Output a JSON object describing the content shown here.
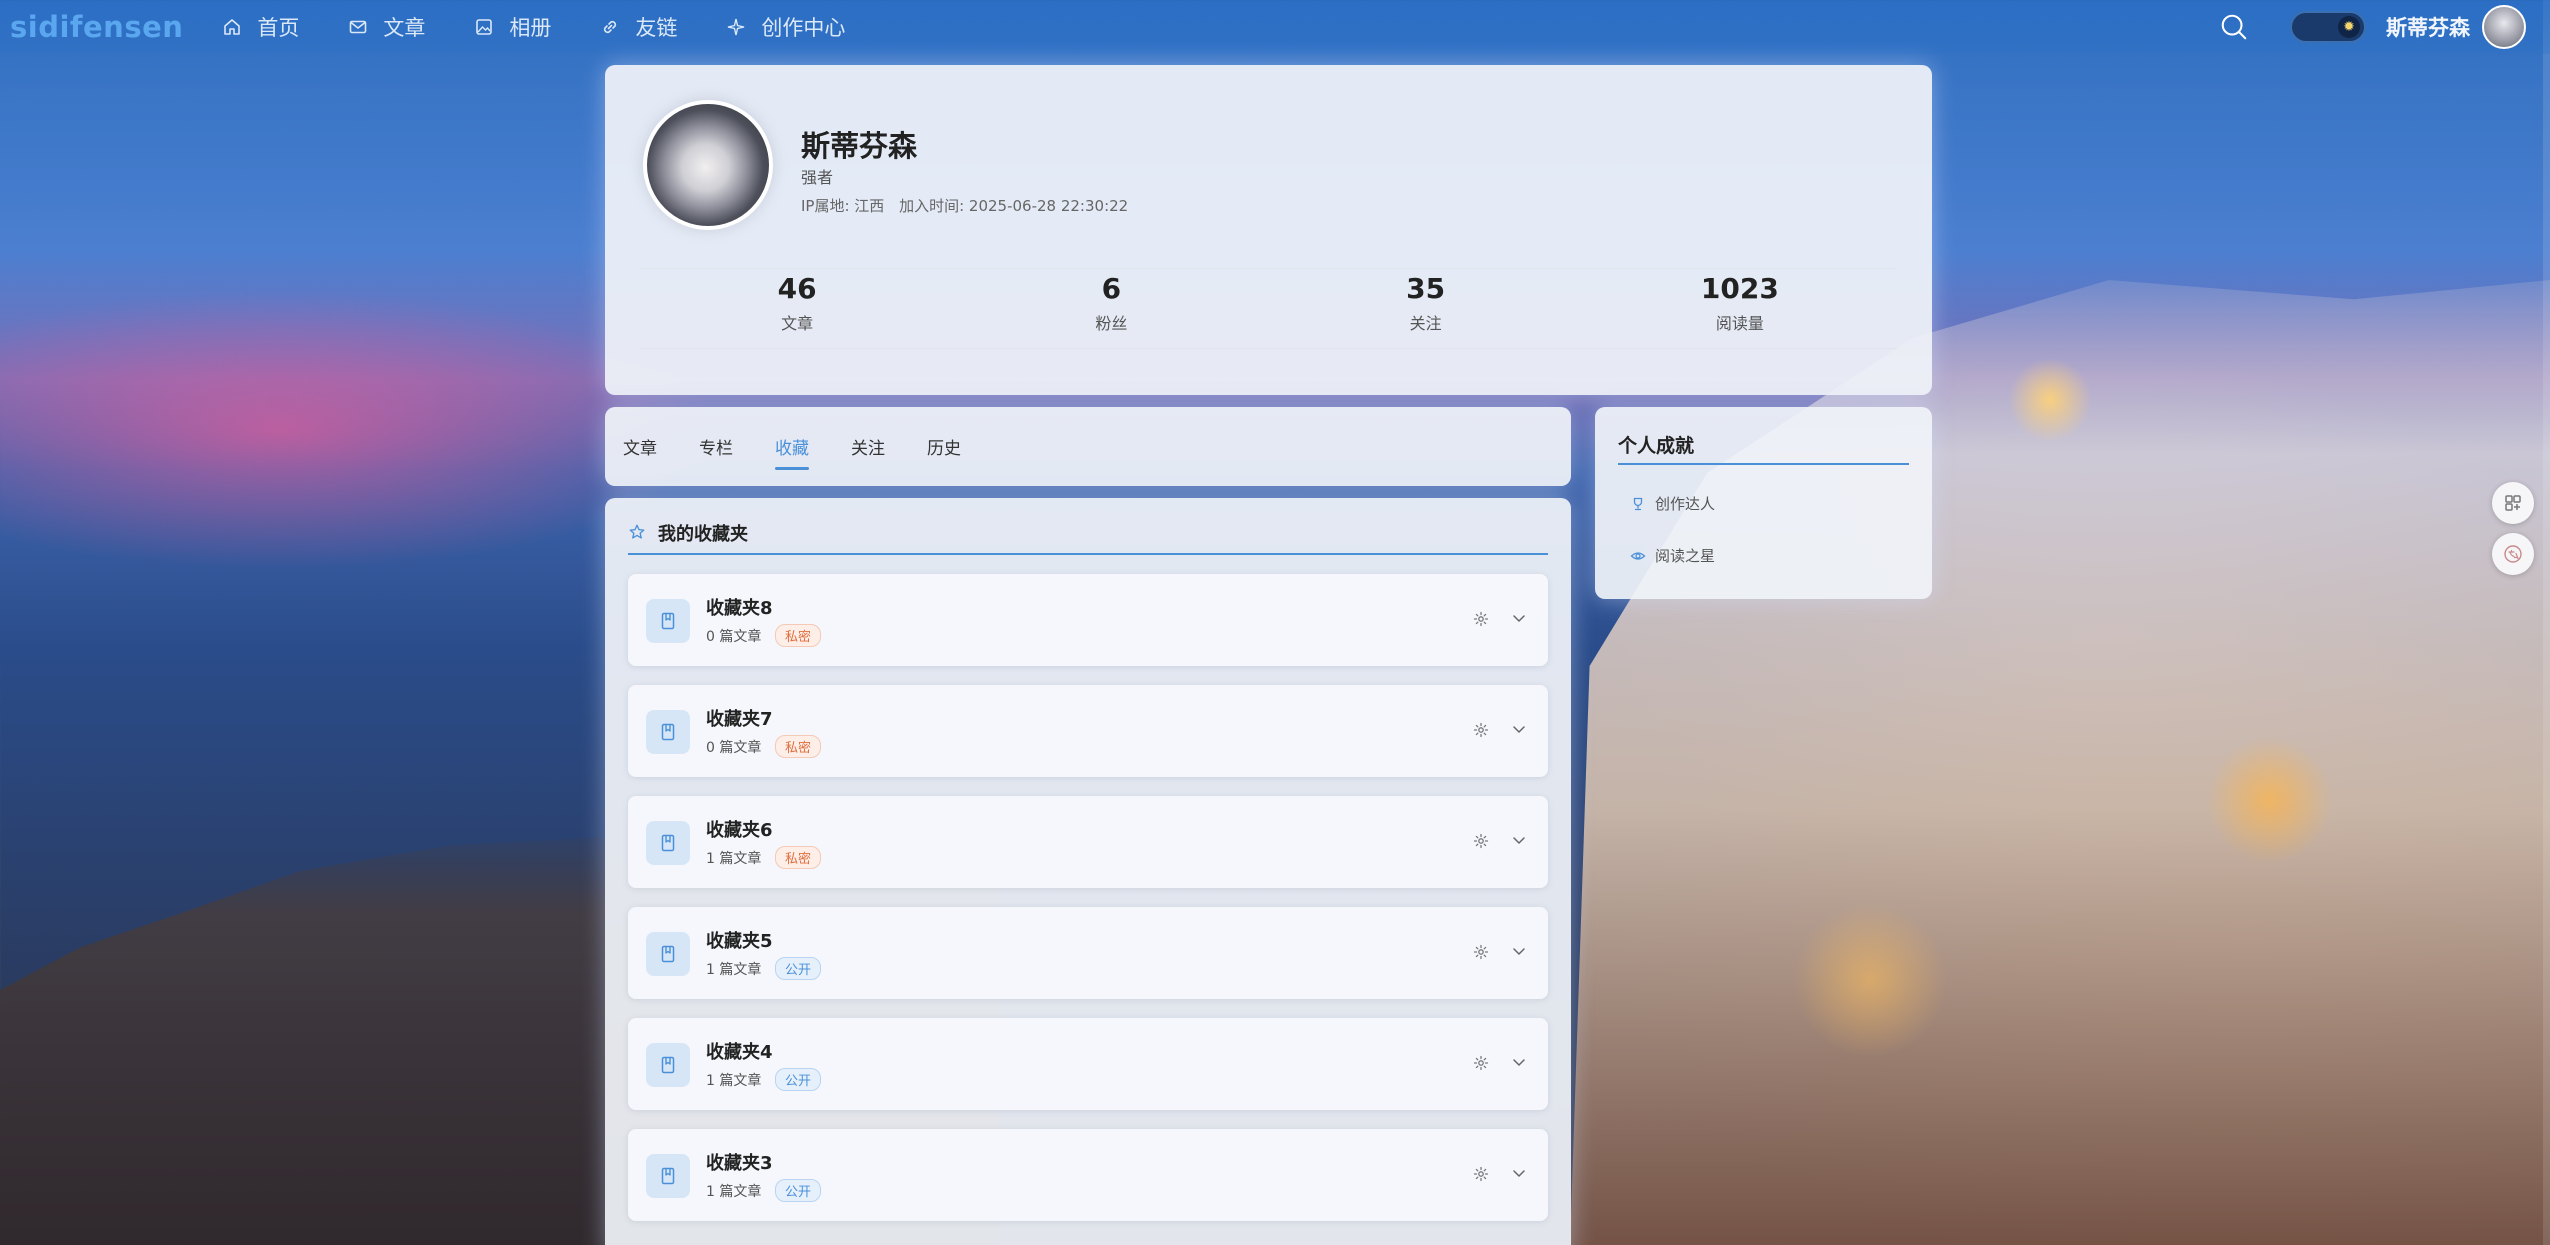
{
  "nav": {
    "brand": "sidifensen",
    "items": [
      {
        "label": "首页",
        "icon": "home-icon"
      },
      {
        "label": "文章",
        "icon": "mail-icon"
      },
      {
        "label": "相册",
        "icon": "image-icon"
      },
      {
        "label": "友链",
        "icon": "link-icon"
      },
      {
        "label": "创作中心",
        "icon": "sparkle-icon"
      }
    ],
    "username": "斯蒂芬森"
  },
  "profile": {
    "name": "斯蒂芬森",
    "role": "强者",
    "ip_label": "IP属地: 江西",
    "join_label": "加入时间: 2025-06-28 22:30:22",
    "stats": [
      {
        "value": "46",
        "label": "文章"
      },
      {
        "value": "6",
        "label": "粉丝"
      },
      {
        "value": "35",
        "label": "关注"
      },
      {
        "value": "1023",
        "label": "阅读量"
      }
    ]
  },
  "tabs": {
    "items": [
      "文章",
      "专栏",
      "收藏",
      "关注",
      "历史"
    ],
    "active": "收藏"
  },
  "achievements": {
    "title": "个人成就",
    "items": [
      {
        "label": "创作达人",
        "icon": "trophy-icon"
      },
      {
        "label": "阅读之星",
        "icon": "eye-icon"
      }
    ]
  },
  "favorites": {
    "title": "我的收藏夹",
    "folders": [
      {
        "name": "收藏夹8",
        "count": "0 篇文章",
        "visibility": "私密",
        "type": "private"
      },
      {
        "name": "收藏夹7",
        "count": "0 篇文章",
        "visibility": "私密",
        "type": "private"
      },
      {
        "name": "收藏夹6",
        "count": "1 篇文章",
        "visibility": "私密",
        "type": "private"
      },
      {
        "name": "收藏夹5",
        "count": "1 篇文章",
        "visibility": "公开",
        "type": "public"
      },
      {
        "name": "收藏夹4",
        "count": "1 篇文章",
        "visibility": "公开",
        "type": "public"
      },
      {
        "name": "收藏夹3",
        "count": "1 篇文章",
        "visibility": "公开",
        "type": "public"
      }
    ]
  },
  "colors": {
    "accent": "#4a90d9",
    "brand": "#5aa7f0",
    "private_badge": "#e07040",
    "public_badge": "#4a90d9"
  }
}
